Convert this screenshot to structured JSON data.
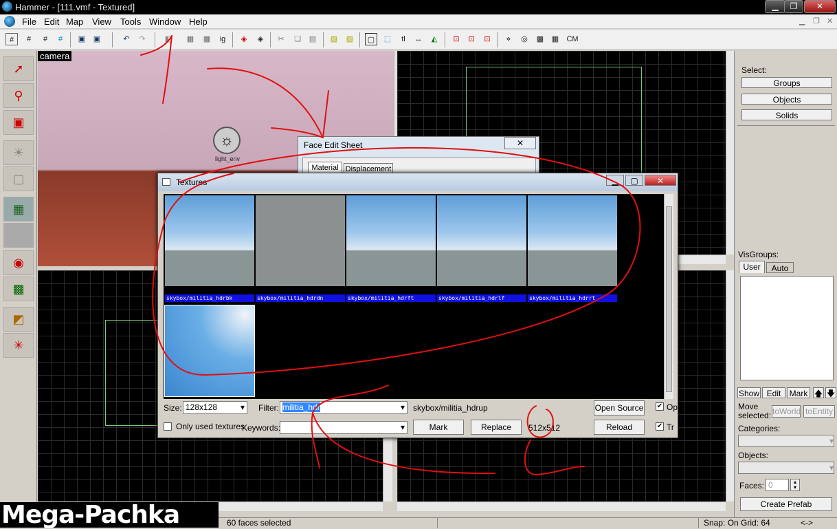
{
  "window": {
    "title": "Hammer - [111.vmf - Textured]",
    "min": "▁",
    "max": "❐",
    "close": "✕"
  },
  "menu": [
    "File",
    "Edit",
    "Map",
    "View",
    "Tools",
    "Window",
    "Help"
  ],
  "toolbar": {
    "tl": "tl",
    "cm": "CM",
    "ig": "ig"
  },
  "viewport": {
    "camera_label": "camera",
    "entity_label": "light_env"
  },
  "right_panel": {
    "select_label": "Select:",
    "groups": "Groups",
    "objects": "Objects",
    "solids": "Solids",
    "visgroups_label": "VisGroups:",
    "tab_user": "User",
    "tab_auto": "Auto",
    "show": "Show",
    "edit": "Edit",
    "mark": "Mark",
    "move_selected": "Move\nselected:",
    "to_world": "toWorld",
    "to_entity": "toEntity",
    "categories": "Categories:",
    "objects_label": "Objects:",
    "faces_label": "Faces:",
    "faces_value": "0",
    "create_prefab": "Create Prefab"
  },
  "face_edit": {
    "title": "Face Edit Sheet",
    "tab_material": "Material",
    "tab_displacement": "Displacement",
    "close": "✕"
  },
  "textures": {
    "title": "Textures",
    "items": [
      {
        "name": "skybox/militia_hdrbk",
        "kind": "sky"
      },
      {
        "name": "skybox/militia_hdrdn",
        "kind": "grey"
      },
      {
        "name": "skybox/militia_hdrft",
        "kind": "sky"
      },
      {
        "name": "skybox/militia_hdrlf",
        "kind": "sky"
      },
      {
        "name": "skybox/militia_hdrrt",
        "kind": "sky"
      },
      {
        "name": "",
        "kind": "skyup"
      }
    ],
    "size_label": "Size:",
    "size_value": "128x128",
    "filter_label": "Filter:",
    "filter_value": "militia_hdr",
    "selected_name": "skybox/militia_hdrup",
    "open_source": "Open Source",
    "only_used": "Only used textures",
    "keywords_label": "Keywords:",
    "mark": "Mark",
    "replace": "Replace",
    "dimensions": "512x512",
    "reload": "Reload",
    "cb_op": "Op",
    "cb_tr": "Tr"
  },
  "status": {
    "selected": "60 faces selected",
    "snap": "Snap: On Grid: 64",
    "arrows": "<->"
  },
  "watermark": "Mega-Pachka",
  "colors": {
    "annotation": "#e01010",
    "texture_label_bg": "#1010e0"
  }
}
